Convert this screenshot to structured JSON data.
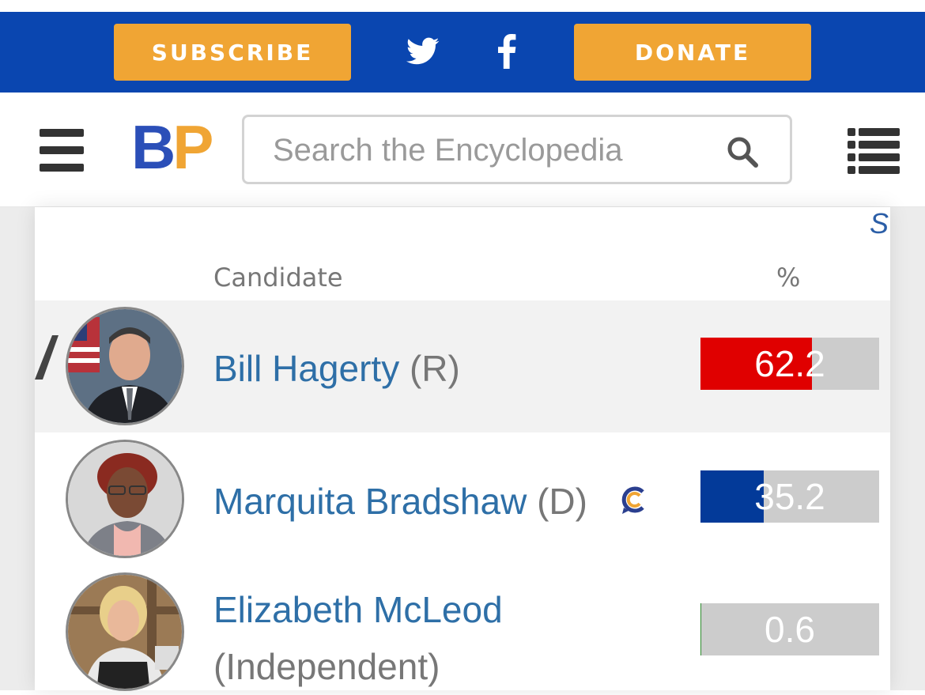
{
  "top_bar": {
    "subscribe_label": "SUBSCRIBE",
    "donate_label": "DONATE",
    "social_icons": [
      "twitter-icon",
      "facebook-icon"
    ],
    "colors": {
      "bar": "#0a46b0",
      "button": "#f0a534"
    }
  },
  "nav": {
    "logo": {
      "b": "B",
      "p": "P"
    },
    "search": {
      "placeholder": "Search the Encyclopedia",
      "value": ""
    },
    "icons": [
      "hamburger-menu-icon",
      "search-icon",
      "list-icon"
    ]
  },
  "results": {
    "corner_link_text": "S",
    "headers": {
      "candidate": "Candidate",
      "percent": "%"
    },
    "rows": [
      {
        "name": "Bill Hagerty",
        "party": "(R)",
        "percent": "62.2",
        "fill_percent": 62.2,
        "color": "#e00000",
        "winner": true,
        "crowdpac": false
      },
      {
        "name": "Marquita Bradshaw",
        "party": "(D)",
        "percent": "35.2",
        "fill_percent": 35.2,
        "color": "#033a99",
        "winner": false,
        "crowdpac": true
      },
      {
        "name": "Elizabeth McLeod",
        "party": "(Independent)",
        "percent": "0.6",
        "fill_percent": 0.6,
        "color": "#2e8b2e",
        "winner": false,
        "crowdpac": false
      }
    ]
  }
}
